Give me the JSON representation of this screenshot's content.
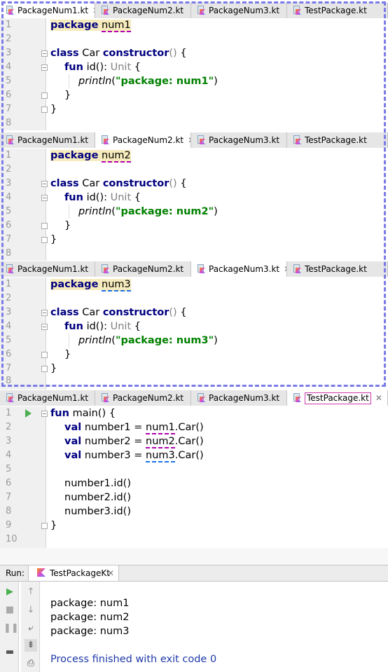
{
  "tabs": [
    "PackageNum1.kt",
    "PackageNum2.kt",
    "PackageNum3.kt",
    "TestPackage.kt"
  ],
  "line_numbers": [
    "1",
    "2",
    "3",
    "4",
    "5",
    "6",
    "7",
    "8",
    "9",
    "10"
  ],
  "editor1": {
    "pkg_kw": "package",
    "pkg_name": "num1",
    "class_kw": "class",
    "class_name": "Car",
    "ctor_kw": "constructor",
    "parens": "()",
    "brace_open": "{",
    "fun_kw": "fun",
    "fun_sig": "id():",
    "ret_type": "Unit",
    "println": "println",
    "str": "\"package: num1\"",
    "close": "}"
  },
  "editor2": {
    "pkg_kw": "package",
    "pkg_name": "num2",
    "class_kw": "class",
    "class_name": "Car",
    "ctor_kw": "constructor",
    "parens": "()",
    "brace_open": "{",
    "fun_kw": "fun",
    "fun_sig": "id():",
    "ret_type": "Unit",
    "println": "println",
    "str": "\"package: num2\"",
    "close": "}"
  },
  "editor3": {
    "pkg_kw": "package",
    "pkg_name": "num3",
    "class_kw": "class",
    "class_name": "Car",
    "ctor_kw": "constructor",
    "parens": "()",
    "brace_open": "{",
    "fun_kw": "fun",
    "fun_sig": "id():",
    "ret_type": "Unit",
    "println": "println",
    "str": "\"package: num3\"",
    "close": "}"
  },
  "editor4": {
    "fun_kw": "fun",
    "main_sig": "main() {",
    "val_kw": "val",
    "decl1_name": "number1 = ",
    "decl1_pkg": "num1",
    "decl1_rest": ".Car()",
    "decl2_name": "number2 = ",
    "decl2_pkg": "num2",
    "decl2_rest": ".Car()",
    "decl3_name": "number3 = ",
    "decl3_pkg": "num3",
    "decl3_rest": ".Car()",
    "call1": "number1.id()",
    "call2": "number2.id()",
    "call3": "number3.id()",
    "close": "}"
  },
  "run": {
    "label": "Run:",
    "tab": "TestPackageKt",
    "output": [
      "package: num1",
      "package: num2",
      "package: num3"
    ],
    "process": "Process finished with exit code 0"
  },
  "colors": {
    "keyword": "#000080",
    "string": "#008000",
    "dash_box": "#7b7be8",
    "highlight": "#f6ebbc"
  }
}
